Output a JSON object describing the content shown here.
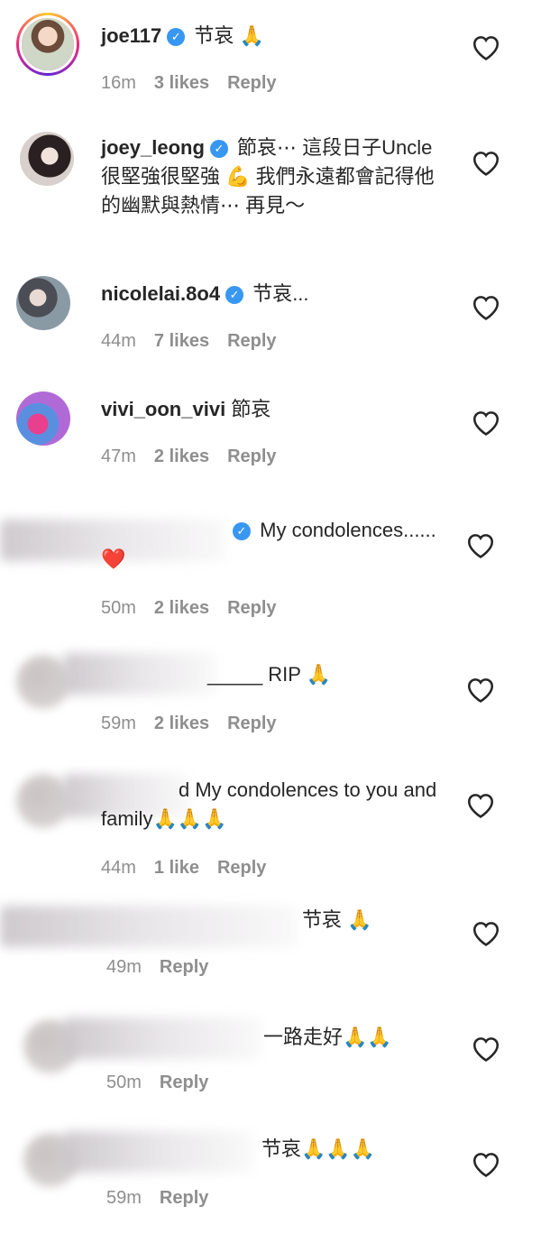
{
  "comments": [
    {
      "username": "joe117",
      "verified": true,
      "text": "节哀 🙏",
      "time": "16m",
      "likes": "3 likes",
      "reply": "Reply",
      "avatar": "pic-a"
    },
    {
      "username": "joey_leong",
      "verified": true,
      "text": "節哀⋯ 這段日子Uncle很堅強很堅強 💪 我們永遠都會記得他的幽默與熱情⋯ 再見～",
      "time": "",
      "likes": "",
      "reply": "",
      "avatar": "pic-b"
    },
    {
      "username": "nicolelai.8o4",
      "verified": true,
      "text": "节哀...",
      "time": "44m",
      "likes": "7 likes",
      "reply": "Reply",
      "avatar": "pic-c"
    },
    {
      "username": "vivi_oon_vivi",
      "verified": false,
      "text": "節哀",
      "time": "47m",
      "likes": "2 likes",
      "reply": "Reply",
      "avatar": "pic-d"
    },
    {
      "username": "",
      "verified": true,
      "text": "My condolences...... ❤️",
      "time": "50m",
      "likes": "2 likes",
      "reply": "Reply"
    },
    {
      "username": "",
      "verified": false,
      "text": "_____ RIP 🙏",
      "time": "59m",
      "likes": "2 likes",
      "reply": "Reply"
    },
    {
      "username": "",
      "verified": false,
      "text": "d My condolences to you and family🙏🙏🙏",
      "time": "44m",
      "likes": "1 like",
      "reply": "Reply"
    },
    {
      "username": "",
      "verified": false,
      "text": "节哀 🙏",
      "time": "49m",
      "likes": "",
      "reply": "Reply"
    },
    {
      "username": "",
      "verified": false,
      "text": "一路走好🙏🙏",
      "time": "50m",
      "likes": "",
      "reply": "Reply"
    },
    {
      "username": "",
      "verified": false,
      "text": "节哀🙏🙏🙏",
      "time": "59m",
      "likes": "",
      "reply": "Reply"
    }
  ],
  "icons": {
    "like": "heart-icon",
    "verified": "verified-badge-icon"
  }
}
